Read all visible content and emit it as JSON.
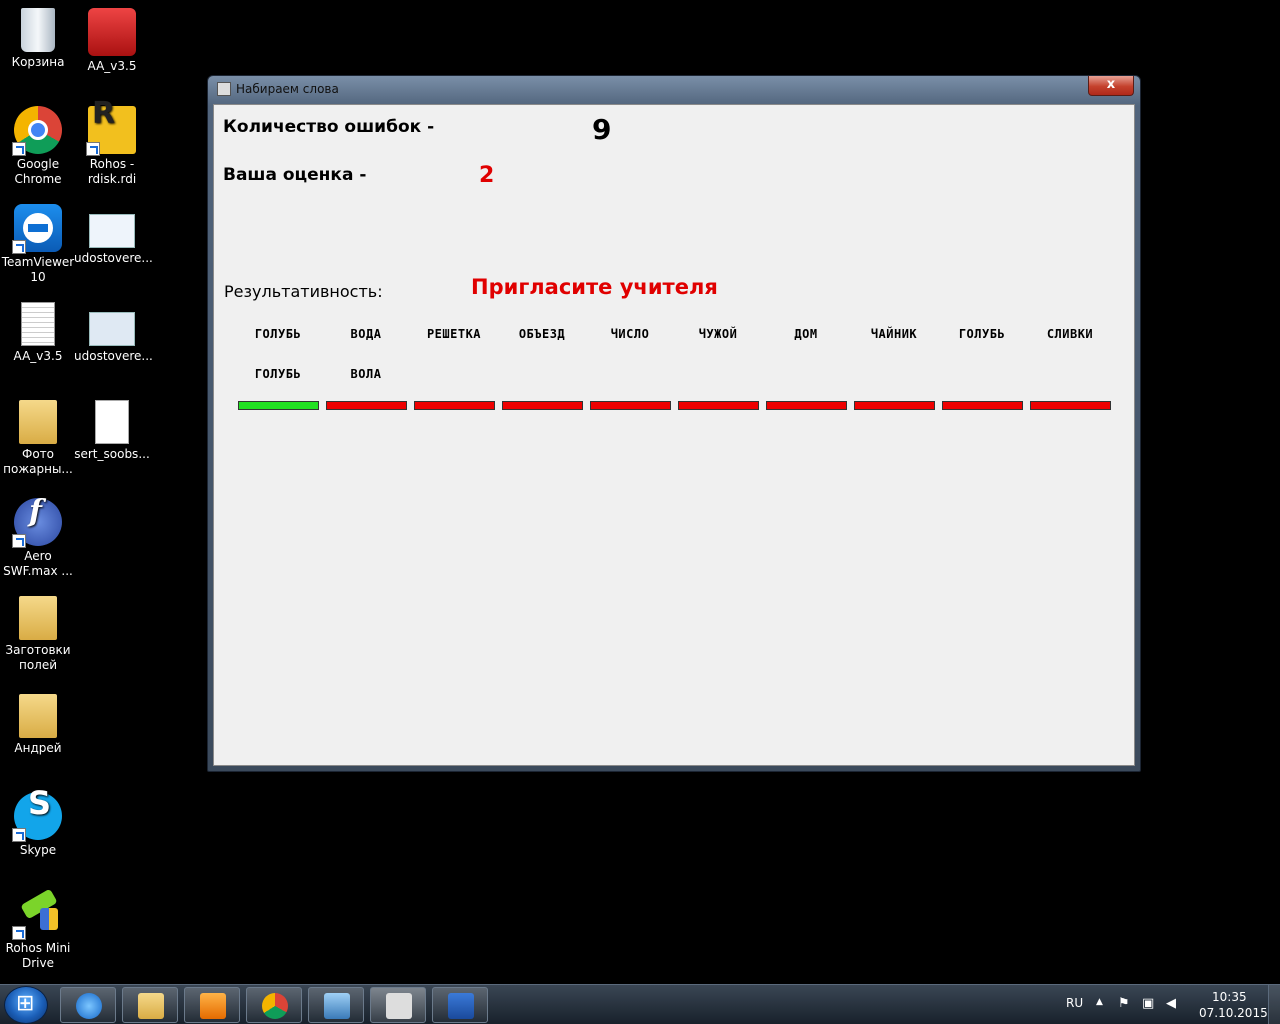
{
  "desktop": {
    "icons": [
      {
        "label": "Корзина"
      },
      {
        "label": "AA_v3.5"
      },
      {
        "label": "Google Chrome"
      },
      {
        "label": "Rohos - rdisk.rdi"
      },
      {
        "label": "TeamViewer 10"
      },
      {
        "label": "udostovere..."
      },
      {
        "label": "AA_v3.5"
      },
      {
        "label": "udostovere..."
      },
      {
        "label": "Фото пожарны..."
      },
      {
        "label": "sert_soobs..."
      },
      {
        "label": "Aero SWF.max ..."
      },
      {
        "label": "Заготовки полей"
      },
      {
        "label": "Андрей"
      },
      {
        "label": "Skype"
      },
      {
        "label": "Rohos Mini Drive"
      }
    ]
  },
  "window": {
    "title": "Набираем слова",
    "close_label": "x",
    "errors_label": "Количество ошибок -",
    "errors_value": "9",
    "grade_label": "Ваша оценка -",
    "grade_value": "2",
    "result_label": "Результативность:",
    "teacher_message": "Пригласите учителя",
    "target_words": [
      "ГОЛУБЬ",
      "ВОДА",
      "РЕШЕТКА",
      "ОБЪЕЗД",
      "ЧИСЛО",
      "ЧУЖОЙ",
      "ДОМ",
      "ЧАЙНИК",
      "ГОЛУБЬ",
      "СЛИВКИ"
    ],
    "typed_words": [
      "ГОЛУБЬ",
      "ВОЛА"
    ],
    "results": [
      "correct",
      "wrong",
      "wrong",
      "wrong",
      "wrong",
      "wrong",
      "wrong",
      "wrong",
      "wrong",
      "wrong"
    ],
    "colors": {
      "correct": "#22e022",
      "wrong": "#ee0000"
    }
  },
  "taskbar": {
    "language": "RU",
    "time": "10:35",
    "date": "07.10.2015"
  }
}
